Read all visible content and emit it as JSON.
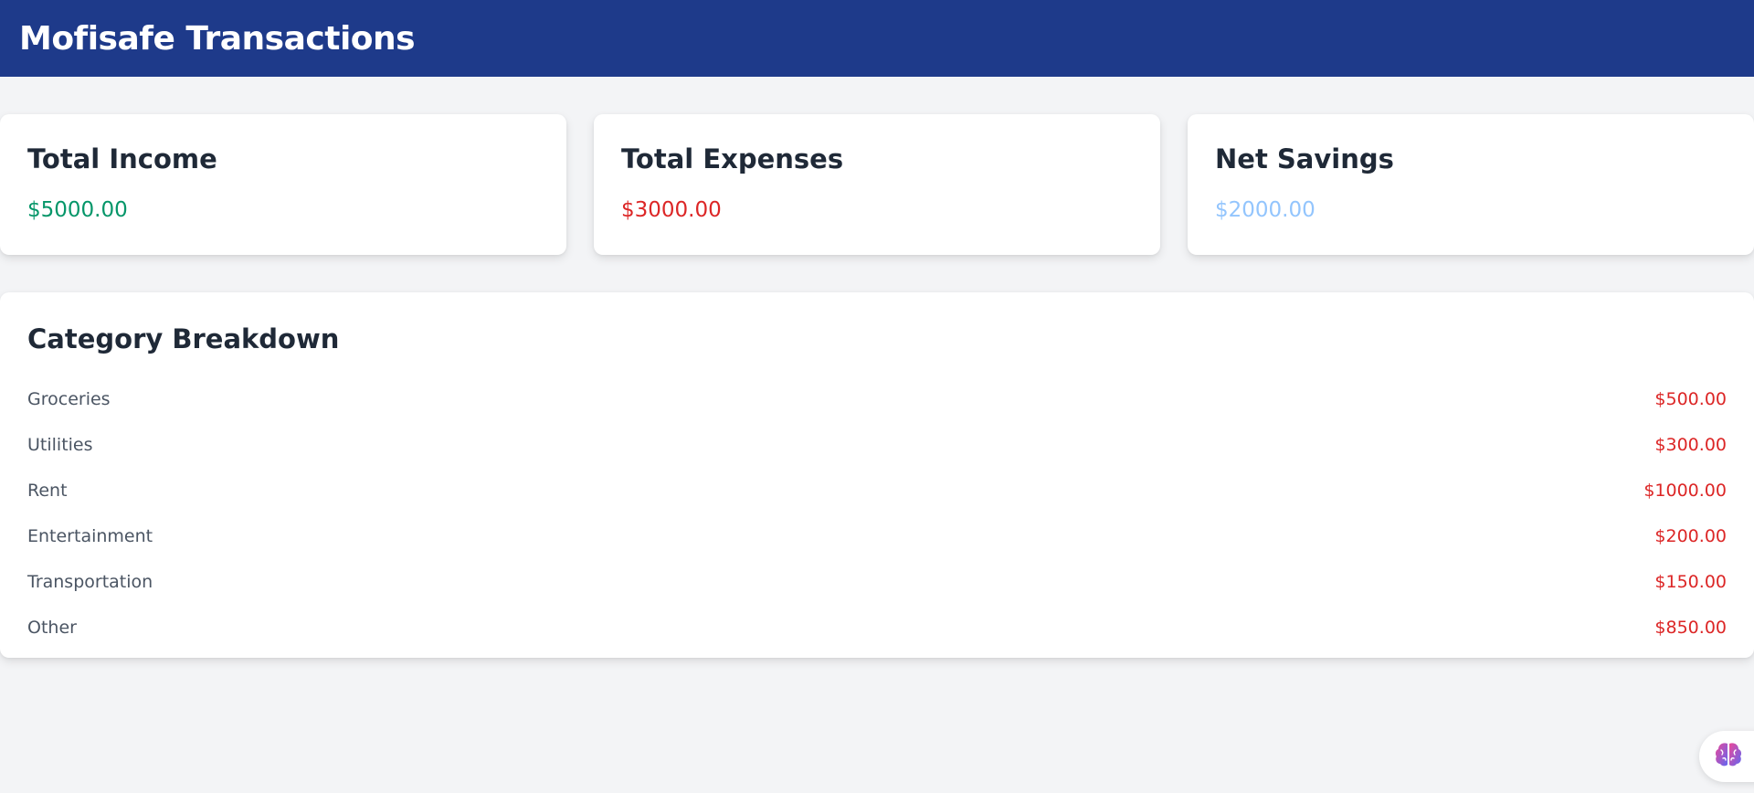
{
  "header": {
    "title": "Mofisafe Transactions"
  },
  "summary": {
    "income": {
      "label": "Total Income",
      "value": "$5000.00",
      "color": "#059669"
    },
    "expenses": {
      "label": "Total Expenses",
      "value": "$3000.00",
      "color": "#dc2626"
    },
    "savings": {
      "label": "Net Savings",
      "value": "$2000.00",
      "color": "#93c5fd"
    }
  },
  "breakdown": {
    "title": "Category Breakdown",
    "items": [
      {
        "name": "Groceries",
        "amount": "$500.00"
      },
      {
        "name": "Utilities",
        "amount": "$300.00"
      },
      {
        "name": "Rent",
        "amount": "$1000.00"
      },
      {
        "name": "Entertainment",
        "amount": "$200.00"
      },
      {
        "name": "Transportation",
        "amount": "$150.00"
      },
      {
        "name": "Other",
        "amount": "$850.00"
      }
    ]
  },
  "floating_button": {
    "icon": "brain-icon"
  }
}
